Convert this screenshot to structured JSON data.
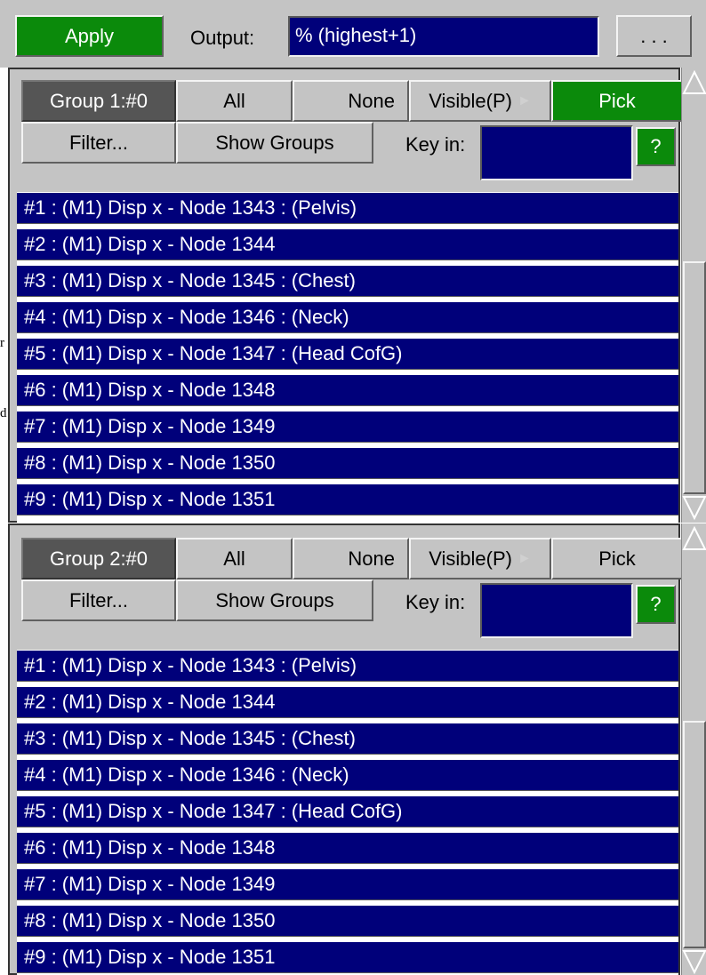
{
  "toolbar": {
    "apply_label": "Apply",
    "output_label": "Output:",
    "output_value": "% (highest+1)",
    "more_label": ". . ."
  },
  "left_fragments": [
    "r",
    "d"
  ],
  "groups": [
    {
      "title": "Group 1:#0",
      "all_label": "All",
      "none_label": "None",
      "visible_label": "Visible(P)",
      "pick_label": "Pick",
      "filter_label": "Filter...",
      "show_groups_label": "Show Groups",
      "keyin_label": "Key in:",
      "keyin_value": "",
      "help_label": "?",
      "items": [
        "#1 : (M1) Disp x - Node 1343 : (Pelvis)",
        "#2 : (M1) Disp x - Node 1344",
        "#3 : (M1) Disp x - Node 1345 : (Chest)",
        "#4 : (M1) Disp x - Node 1346 : (Neck)",
        "#5 : (M1) Disp x - Node 1347 : (Head CofG)",
        "#6 : (M1) Disp x - Node 1348",
        "#7 : (M1) Disp x - Node 1349",
        "#8 : (M1) Disp x - Node 1350",
        "#9 : (M1) Disp x - Node 1351"
      ]
    },
    {
      "title": "Group 2:#0",
      "all_label": "All",
      "none_label": "None",
      "visible_label": "Visible(P)",
      "pick_label": "Pick",
      "filter_label": "Filter...",
      "show_groups_label": "Show Groups",
      "keyin_label": "Key in:",
      "keyin_value": "",
      "help_label": "?",
      "items": [
        "#1 : (M1) Disp x - Node 1343 : (Pelvis)",
        "#2 : (M1) Disp x - Node 1344",
        "#3 : (M1) Disp x - Node 1345 : (Chest)",
        "#4 : (M1) Disp x - Node 1346 : (Neck)",
        "#5 : (M1) Disp x - Node 1347 : (Head CofG)",
        "#6 : (M1) Disp x - Node 1348",
        "#7 : (M1) Disp x - Node 1349",
        "#8 : (M1) Disp x - Node 1350",
        "#9 : (M1) Disp x - Node 1351"
      ]
    }
  ],
  "colors": {
    "panel": "#c4c4c4",
    "list_bg": "#00007a",
    "apply_green": "#0b8a0b",
    "group_title_bg": "#555555"
  }
}
